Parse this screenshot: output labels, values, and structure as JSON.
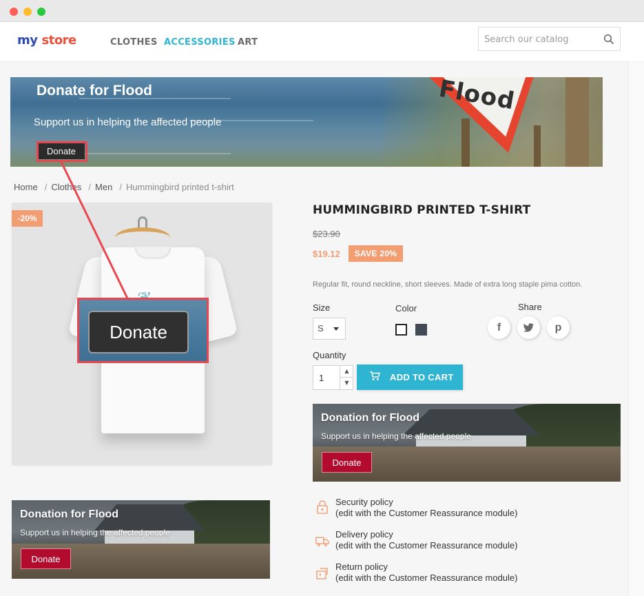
{
  "header": {
    "logo_my": "my",
    "logo_store": "store",
    "nav": [
      {
        "label": "CLOTHES"
      },
      {
        "label": "ACCESSORIES"
      },
      {
        "label": "ART"
      }
    ],
    "search_placeholder": "Search our catalog"
  },
  "top_banner": {
    "title": "Donate for Flood",
    "subtitle": "Support us in helping the affected people",
    "button": "Donate",
    "sign_text": "Flood"
  },
  "callout": {
    "button": "Donate"
  },
  "breadcrumb": [
    "Home",
    "Clothes",
    "Men",
    "Hummingbird printed t-shirt"
  ],
  "product": {
    "discount_badge": "-20%",
    "title": "HUMMINGBIRD PRINTED T-SHIRT",
    "old_price": "$23.90",
    "new_price": "$19.12",
    "save_badge": "SAVE 20%",
    "description": "Regular fit, round neckline, short sleeves. Made of extra long staple pima cotton.",
    "size_label": "Size",
    "size_value": "S",
    "color_label": "Color",
    "share_label": "Share",
    "share_buttons": [
      "f",
      "t",
      "p"
    ],
    "quantity_label": "Quantity",
    "quantity_value": "1",
    "add_to_cart": "ADD TO CART"
  },
  "side_banner": {
    "title": "Donation for Flood",
    "subtitle": "Support us in helping the affected people",
    "button": "Donate"
  },
  "product_banner": {
    "title": "Donation for Flood",
    "subtitle": "Support us in helping the affected people",
    "button": "Donate"
  },
  "reassurance": [
    {
      "title": "Security policy",
      "detail": "(edit with the Customer Reassurance module)",
      "icon": "shield-icon"
    },
    {
      "title": "Delivery policy",
      "detail": "(edit with the Customer Reassurance module)",
      "icon": "truck-icon"
    },
    {
      "title": "Return policy",
      "detail": "(edit with the Customer Reassurance module)",
      "icon": "return-icon"
    }
  ],
  "colors": {
    "accent": "#2fb5d2",
    "discount": "#f39d72",
    "highlight": "#e9474f",
    "donate_red": "#b20b2d"
  }
}
